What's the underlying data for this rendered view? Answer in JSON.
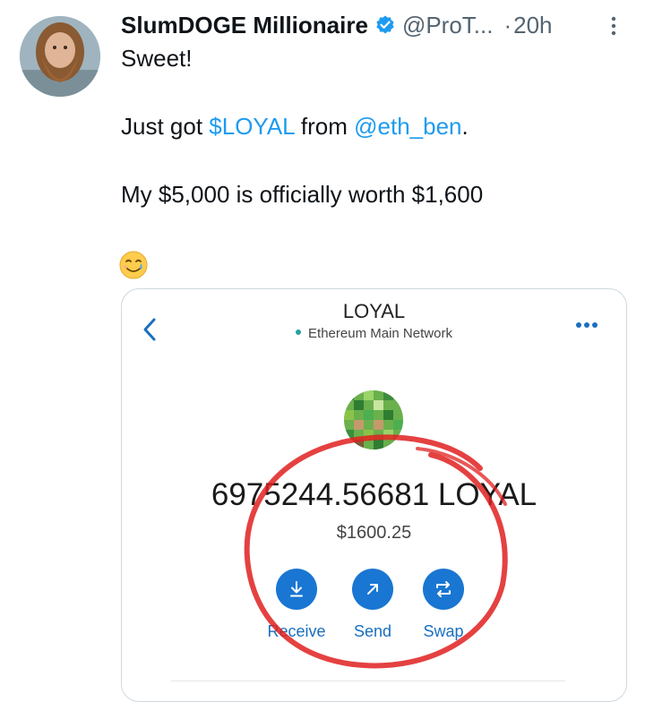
{
  "tweet": {
    "display_name": "SlumDOGE Millionaire",
    "handle": "@ProT...",
    "separator": "·",
    "time": "20h",
    "line1": "Sweet!",
    "line2_prefix": "Just got ",
    "cashtag": "$LOYAL",
    "line2_mid": " from ",
    "mention": "@eth_ben",
    "line2_suffix": ".",
    "line3": "My $5,000 is officially worth $1,600",
    "emoji": "🥲",
    "icons": {
      "verified": "verified-badge-icon",
      "more": "more-options-icon"
    },
    "colors": {
      "link": "#1d9bf0",
      "secondary_text": "#536471",
      "verified": "#1d9bf0"
    }
  },
  "wallet": {
    "title": "LOYAL",
    "network": "Ethereum Main Network",
    "balance": "6975244.56681 LOYAL",
    "usd_value": "$1600.25",
    "actions": [
      {
        "label": "Receive",
        "icon": "download-arrow-icon"
      },
      {
        "label": "Send",
        "icon": "send-arrow-icon"
      },
      {
        "label": "Swap",
        "icon": "swap-arrows-icon"
      }
    ],
    "colors": {
      "action_button": "#1976d2",
      "network_dot": "#28a0a0",
      "annotation_circle": "#e02020"
    }
  }
}
